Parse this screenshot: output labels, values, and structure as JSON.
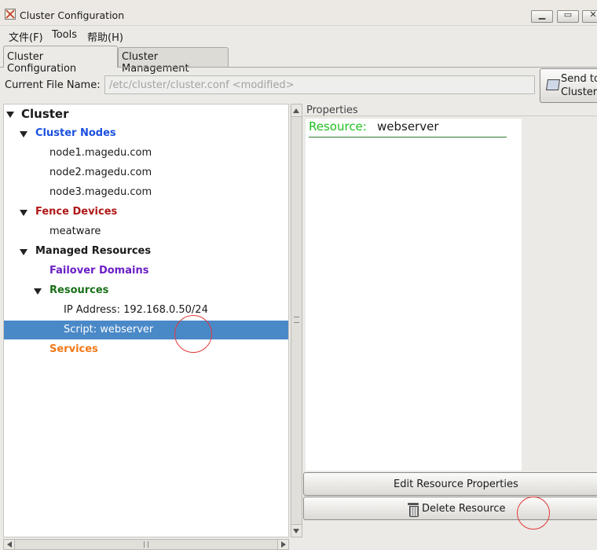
{
  "window": {
    "title": "Cluster Configuration"
  },
  "menu": {
    "file": "文件(F)",
    "tools": "Tools",
    "help": "帮助(H)"
  },
  "tabs": {
    "config": "Cluster Configuration",
    "management": "Cluster Management"
  },
  "file_row": {
    "label": "Current File Name:",
    "value": "/etc/cluster/cluster.conf <modified>",
    "send_line1": "Send to",
    "send_line2": "Cluster"
  },
  "tree": {
    "cluster": "Cluster",
    "cluster_nodes": "Cluster Nodes",
    "node1": "node1.magedu.com",
    "node2": "node2.magedu.com",
    "node3": "node3.magedu.com",
    "fence_devices": "Fence Devices",
    "meatware": "meatware",
    "managed_resources": "Managed Resources",
    "failover_domains": "Failover Domains",
    "resources": "Resources",
    "ip_address": "IP Address:  192.168.0.50/24",
    "script": "Script:  webserver",
    "services": "Services"
  },
  "properties": {
    "label": "Properties",
    "resource_key": "Resource:",
    "resource_value": "webserver"
  },
  "buttons": {
    "edit": "Edit Resource Properties",
    "delete": "Delete Resource"
  },
  "colors": {
    "selection": "#4a89c8",
    "cluster_nodes": "#1a50e0",
    "fence_devices": "#b01818",
    "failover_domains": "#6a1fc4",
    "resources": "#197019",
    "services": "#f07818",
    "resource_key": "#1ec01e",
    "annotation": "#e23a3a"
  }
}
